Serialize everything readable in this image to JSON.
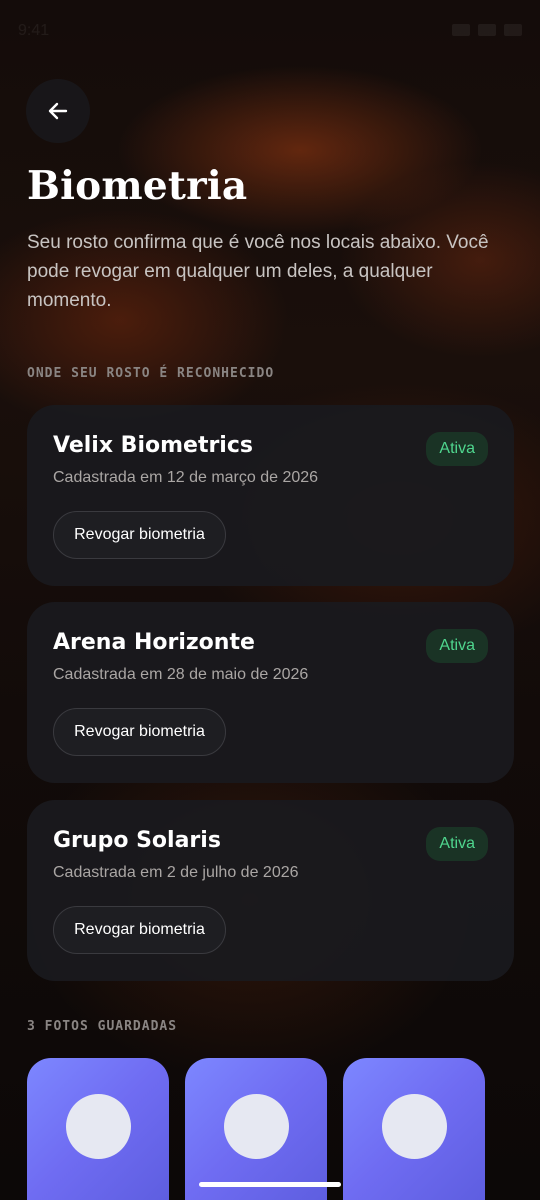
{
  "status_bar": {
    "time": "9:41",
    "icons": [
      "wifi-icon",
      "signal-icon",
      "battery-icon"
    ]
  },
  "header": {
    "back_icon": "arrow-left-icon",
    "title": "Biometria",
    "subtitle": "Seu rosto confirma que é você nos locais abaixo. Você pode revogar em qualquer um deles, a qualquer momento."
  },
  "sections": {
    "recognized_label": "ONDE SEU ROSTO É RECONHECIDO",
    "photos_label": "3 FOTOS GUARDADAS"
  },
  "locations": [
    {
      "name": "Velix Biometrics",
      "registered": "Cadastrada em 12 de março de 2026",
      "status": "Ativa",
      "action": "Revogar biometria"
    },
    {
      "name": "Arena Horizonte",
      "registered": "Cadastrada em 28 de maio de 2026",
      "status": "Ativa",
      "action": "Revogar biometria"
    },
    {
      "name": "Grupo Solaris",
      "registered": "Cadastrada em 2 de julho de 2026",
      "status": "Ativa",
      "action": "Revogar biometria"
    }
  ],
  "photos": [
    {
      "icon": "face-placeholder-icon"
    },
    {
      "icon": "face-placeholder-icon"
    },
    {
      "icon": "face-placeholder-icon"
    }
  ],
  "colors": {
    "accent_active": "#4fd68e",
    "badge_bg": "#1a3325",
    "card_bg": "#1a1a1e",
    "photo_gradient_start": "#7d87ff",
    "photo_gradient_end": "#5e5ee0"
  }
}
